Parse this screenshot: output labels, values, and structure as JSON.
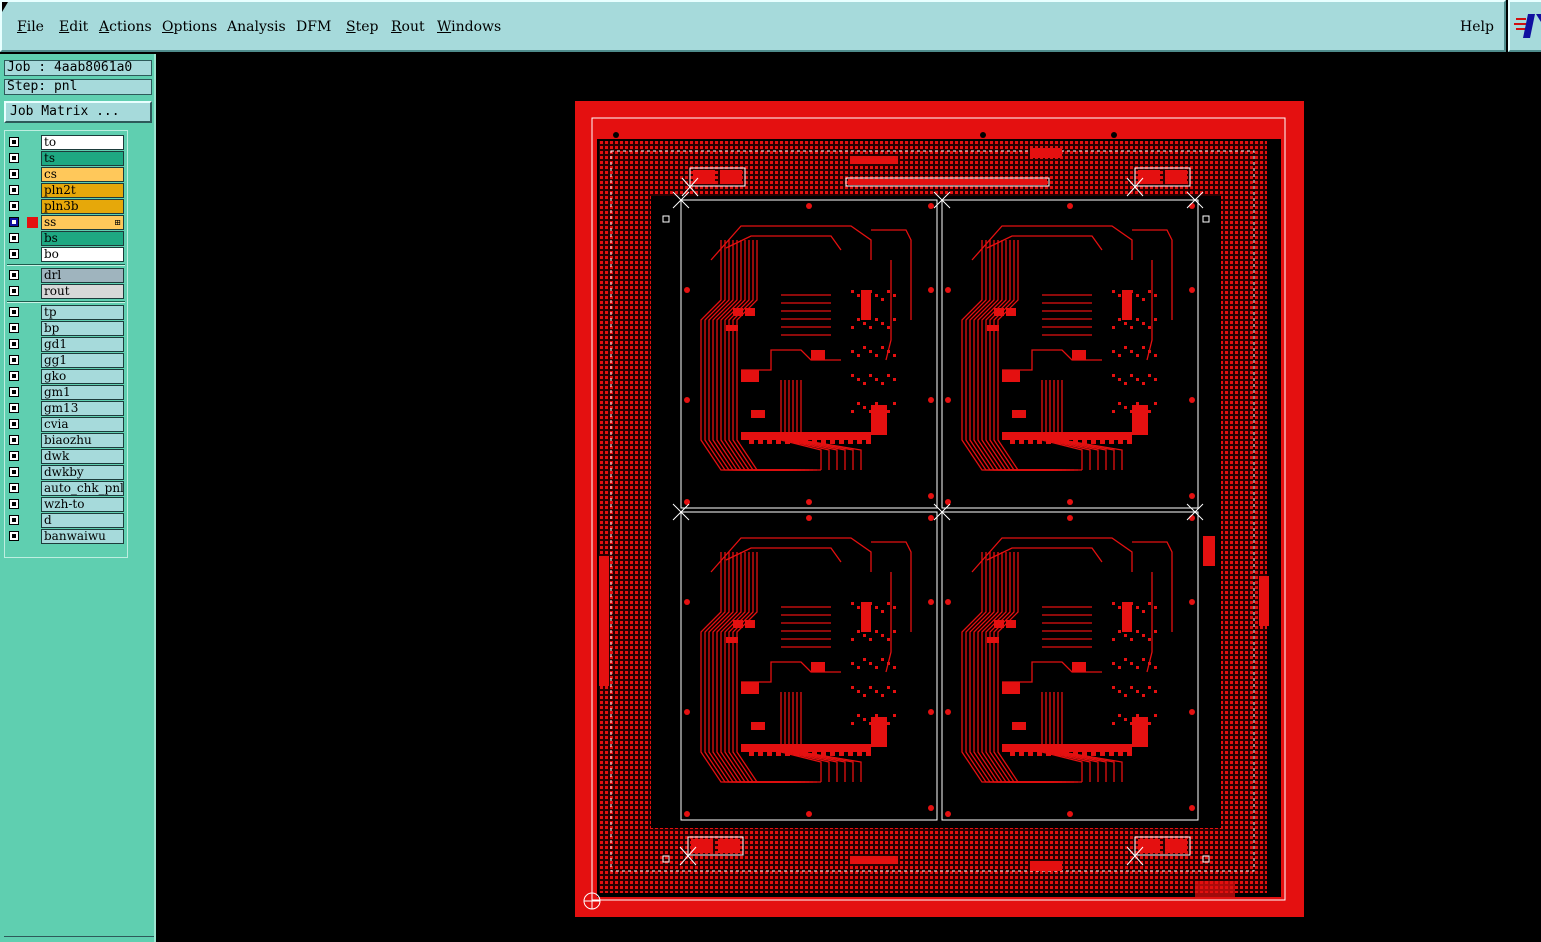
{
  "menu": {
    "items": [
      {
        "label": "File",
        "mnemonic": "F",
        "rest": "ile"
      },
      {
        "label": "Edit",
        "mnemonic": "E",
        "rest": "dit"
      },
      {
        "label": "Actions",
        "mnemonic": "A",
        "rest": "ctions"
      },
      {
        "label": "Options",
        "mnemonic": "O",
        "rest": "ptions"
      },
      {
        "label": "Analysis",
        "mnemonic": "A",
        "rest": "nalysis"
      },
      {
        "label": "DFM",
        "mnemonic": "",
        "rest": "DFM"
      },
      {
        "label": "Step",
        "mnemonic": "S",
        "rest": "tep"
      },
      {
        "label": "Rout",
        "mnemonic": "R",
        "rest": "out"
      },
      {
        "label": "Windows",
        "mnemonic": "W",
        "rest": "indows"
      }
    ],
    "help": "Help"
  },
  "job_label": "Job : 4aab8061a0",
  "step_label": "Step: pnl",
  "job_matrix_label": "Job Matrix ...",
  "layers": {
    "board_group": [
      {
        "name": "to",
        "color": "#ffffff"
      },
      {
        "name": "ts",
        "color": "#1ea882"
      },
      {
        "name": "cs",
        "color": "#ffc85a"
      },
      {
        "name": "pln2t",
        "color": "#e6a80a"
      },
      {
        "name": "pln3b",
        "color": "#e6a80a"
      },
      {
        "name": "ss",
        "color": "#ffc85a",
        "selected": true,
        "work": true
      },
      {
        "name": "bs",
        "color": "#1ea882"
      },
      {
        "name": "bo",
        "color": "#ffffff"
      }
    ],
    "drill_group": [
      {
        "name": "drl",
        "color": "#9fb4be"
      },
      {
        "name": "rout",
        "color": "#d8d8d8"
      }
    ],
    "misc_group": [
      {
        "name": "tp",
        "color": "#a6dadb"
      },
      {
        "name": "bp",
        "color": "#a6dadb"
      },
      {
        "name": "gd1",
        "color": "#a6dadb"
      },
      {
        "name": "gg1",
        "color": "#a6dadb"
      },
      {
        "name": "gko",
        "color": "#a6dadb"
      },
      {
        "name": "gm1",
        "color": "#a6dadb"
      },
      {
        "name": "gm13",
        "color": "#a6dadb"
      },
      {
        "name": "cvia",
        "color": "#a6dadb"
      },
      {
        "name": "biaozhu",
        "color": "#a6dadb"
      },
      {
        "name": "dwk",
        "color": "#a6dadb"
      },
      {
        "name": "dwkby",
        "color": "#a6dadb"
      },
      {
        "name": "auto_chk_pnl",
        "color": "#a6dadb"
      },
      {
        "name": "wzh-to",
        "color": "#a6dadb"
      },
      {
        "name": "d",
        "color": "#a6dadb"
      },
      {
        "name": "banwaiwu",
        "color": "#a6dadb"
      }
    ]
  },
  "colors": {
    "copper": "#e41010",
    "menubar": "#a6dadb",
    "panel": "#5fcfb0",
    "work_layer_marker": "#e41010"
  },
  "board": {
    "panel_rows": 2,
    "panel_cols": 2,
    "layer_shown": "ss"
  }
}
